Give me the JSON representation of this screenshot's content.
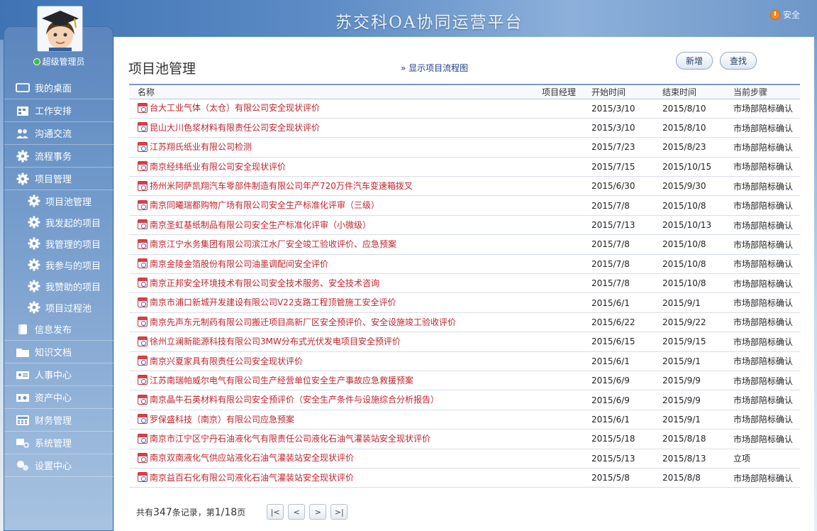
{
  "header": {
    "app_title": "苏交科OA协同运营平台",
    "logout_label": "安全"
  },
  "user": {
    "name": "超级管理员"
  },
  "nav": [
    {
      "label": "我的桌面",
      "icon": "monitor-icon",
      "sub": false
    },
    {
      "label": "工作安排",
      "icon": "calendar-icon",
      "sub": false
    },
    {
      "label": "沟通交流",
      "icon": "people-icon",
      "sub": false
    },
    {
      "label": "流程事务",
      "icon": "gear-icon",
      "sub": false
    },
    {
      "label": "项目管理",
      "icon": "gear-icon",
      "sub": false
    },
    {
      "label": "项目池管理",
      "icon": "gear-icon",
      "sub": true
    },
    {
      "label": "我发起的项目",
      "icon": "gear-icon",
      "sub": true
    },
    {
      "label": "我管理的项目",
      "icon": "gear-icon",
      "sub": true
    },
    {
      "label": "我参与的项目",
      "icon": "gear-icon",
      "sub": true
    },
    {
      "label": "我赞助的项目",
      "icon": "gear-icon",
      "sub": true
    },
    {
      "label": "项目过程池",
      "icon": "gear-icon",
      "sub": true
    },
    {
      "label": "信息发布",
      "icon": "book-icon",
      "sub": false
    },
    {
      "label": "知识文档",
      "icon": "folder-icon",
      "sub": false
    },
    {
      "label": "人事中心",
      "icon": "id-card-icon",
      "sub": false
    },
    {
      "label": "资产中心",
      "icon": "assets-icon",
      "sub": false
    },
    {
      "label": "财务管理",
      "icon": "calculator-icon",
      "sub": false
    },
    {
      "label": "系统管理",
      "icon": "system-icon",
      "sub": false
    },
    {
      "label": "设置中心",
      "icon": "settings-icon",
      "sub": false
    }
  ],
  "page": {
    "title": "项目池管理",
    "flow_link": "» 显示项目流程图",
    "add_button": "新增",
    "find_button": "查找"
  },
  "table": {
    "headers": [
      "名称",
      "项目经理",
      "开始时间",
      "结束时间",
      "当前步骤"
    ],
    "rows": [
      {
        "name": "台大工业气体（太仓）有限公司安全现状评价",
        "manager": "",
        "start": "2015/3/10",
        "end": "2015/8/10",
        "step": "市场部陪标确认"
      },
      {
        "name": "昆山大川色浆材料有限责任公司安全现状评价",
        "manager": "",
        "start": "2015/3/10",
        "end": "2015/8/10",
        "step": "市场部陪标确认"
      },
      {
        "name": "江苏翔氏纸业有限公司检测",
        "manager": "",
        "start": "2015/7/23",
        "end": "2015/8/23",
        "step": "市场部陪标确认"
      },
      {
        "name": "南京经纬纸业有限公司安全现状评价",
        "manager": "",
        "start": "2015/7/15",
        "end": "2015/10/15",
        "step": "市场部陪标确认"
      },
      {
        "name": "扬州米阿萨凯翔汽车零部件制造有限公司年产720万件汽车变速箱拨叉",
        "manager": "",
        "start": "2015/6/30",
        "end": "2015/9/30",
        "step": "市场部陪标确认"
      },
      {
        "name": "南京同曦瑞都购物广场有限公司安全生产标准化评审（三级）",
        "manager": "",
        "start": "2015/7/8",
        "end": "2015/10/8",
        "step": "市场部陪标确认"
      },
      {
        "name": "南京圣虹基纸制品有限公司安全生产标准化评审（小微级）",
        "manager": "",
        "start": "2015/7/13",
        "end": "2015/10/13",
        "step": "市场部陪标确认"
      },
      {
        "name": "南京江宁水务集团有限公司滨江水厂安全竣工验收评价、应急预案",
        "manager": "",
        "start": "2015/7/8",
        "end": "2015/10/8",
        "step": "市场部陪标确认"
      },
      {
        "name": "南京金陵金箔股份有限公司油墨调配间安全评价",
        "manager": "",
        "start": "2015/7/8",
        "end": "2015/10/8",
        "step": "市场部陪标确认"
      },
      {
        "name": "南京正邦安全环境技术有限公司安全技术服务、安全技术咨询",
        "manager": "",
        "start": "2015/7/8",
        "end": "2015/10/8",
        "step": "市场部陪标确认"
      },
      {
        "name": "南京市浦口新城开发建设有限公司V22支路工程顶管施工安全评价",
        "manager": "",
        "start": "2015/6/1",
        "end": "2015/9/1",
        "step": "市场部陪标确认"
      },
      {
        "name": "南京先声东元制药有限公司搬迁项目高新厂区安全预评价、安全设施竣工验收评价",
        "manager": "",
        "start": "2015/6/22",
        "end": "2015/9/22",
        "step": "市场部陪标确认"
      },
      {
        "name": "徐州立澜新能源科技有限公司3MW分布式光伏发电项目安全预评价",
        "manager": "",
        "start": "2015/6/15",
        "end": "2015/9/15",
        "step": "市场部陪标确认"
      },
      {
        "name": "南京兴夏家具有限责任公司安全现状评价",
        "manager": "",
        "start": "2015/6/1",
        "end": "2015/9/1",
        "step": "市场部陪标确认"
      },
      {
        "name": "江苏南瑞帕威尔电气有限公司生产经营单位安全生产事故应急救援预案",
        "manager": "",
        "start": "2015/6/9",
        "end": "2015/9/9",
        "step": "市场部陪标确认"
      },
      {
        "name": "南京晶牛石英材料有限公司安全预评价（安全生产条件与设施综合分析报告）",
        "manager": "",
        "start": "2015/6/9",
        "end": "2015/9/9",
        "step": "市场部陪标确认"
      },
      {
        "name": "罗保盛科技（南京）有限公司应急预案",
        "manager": "",
        "start": "2015/6/1",
        "end": "2015/9/1",
        "step": "市场部陪标确认"
      },
      {
        "name": "南京市江宁区宁丹石油液化气有限责任公司液化石油气灌装站安全现状评价",
        "manager": "",
        "start": "2015/5/18",
        "end": "2015/8/18",
        "step": "市场部陪标确认"
      },
      {
        "name": "南京双南液化气供应站液化石油气灌装站安全现状评价",
        "manager": "",
        "start": "2015/5/13",
        "end": "2015/8/13",
        "step": "立项"
      },
      {
        "name": "南京益百石化有限公司液化石油气灌装站安全现状评价",
        "manager": "",
        "start": "2015/5/8",
        "end": "2015/8/8",
        "step": "市场部陪标确认"
      }
    ]
  },
  "pager": {
    "prefix": "共有",
    "total": "347",
    "mid": "条记录，第",
    "current": "1/18",
    "suffix": "页",
    "first": "|<",
    "prev": "<",
    "next": ">",
    "last": ">|"
  }
}
